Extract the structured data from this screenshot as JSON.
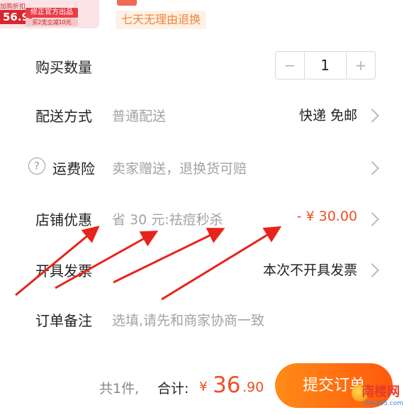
{
  "header": {
    "thumb_price": "56.9",
    "thumb_badge1": "修正官方出品",
    "thumb_badge2": "买2支立减10元",
    "thumb_tag": "加购折扣",
    "return_policy": "七天无理由退换"
  },
  "rows": {
    "quantity": {
      "label": "购买数量",
      "value": "1",
      "minus": "−",
      "plus": "+"
    },
    "delivery": {
      "label": "配送方式",
      "sub": "普通配送",
      "value": "快递 免邮"
    },
    "insurance": {
      "label": "运费险",
      "sub": "卖家赠送，退换货可赔",
      "icon": "?"
    },
    "discount": {
      "label": "店铺优惠",
      "sub": "省 30 元:祛痘秒杀",
      "value": "- ¥ 30.00"
    },
    "invoice": {
      "label": "开具发票",
      "value": "本次不开具发票"
    },
    "remark": {
      "label": "订单备注",
      "placeholder": "选填,请先和商家协商一致"
    }
  },
  "footer": {
    "count": "共1件,",
    "total_label": "合计:",
    "currency": "¥",
    "total_int": "36",
    "total_dec": ".90",
    "submit_label": "提交订单"
  },
  "watermark": {
    "text": "南楼网",
    "url": "nlw365.com"
  },
  "colors": {
    "accent": "#f04e24",
    "button": "#ff6b10",
    "arrow": "#e8231a"
  },
  "icons": [
    "info-icon",
    "chevron-right-icon",
    "minus-icon",
    "plus-icon"
  ]
}
